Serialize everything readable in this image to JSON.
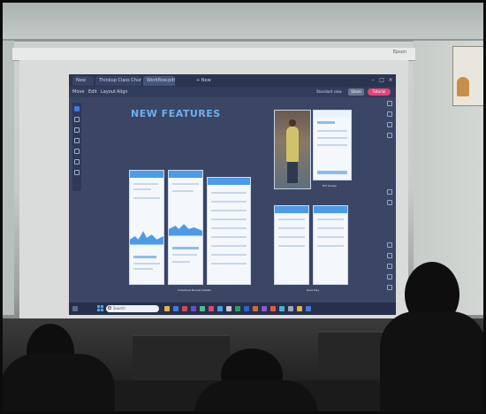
{
  "photo": {
    "description_colors": {
      "desktop_bg": "#3a4664",
      "accent_blue": "#4d9be8",
      "pink_button": "#e0457a"
    }
  },
  "poster": {
    "text": "",
    "figure": "poster-figure"
  },
  "screen": {
    "brand": "Epson"
  },
  "desktop": {
    "tabs": [
      "New",
      "Thinkup Class Church Studio",
      "Workflow.pdf",
      "+  New"
    ],
    "menu": [
      "Move",
      "Edit",
      "Layout",
      "Align"
    ],
    "zoom_label": "Standard view",
    "share_label": "Share",
    "tutorial_label": "Tutorial",
    "canvas": {
      "headline": "NEW FEATURES",
      "subhead": "",
      "paragraph": "",
      "caption_left": "Individual Runner Details",
      "caption_right_top": "Full Screen",
      "caption_right_bottom": "Race Day"
    },
    "taskbar": {
      "search_placeholder": "Search",
      "clock_time": "",
      "clock_date": ""
    }
  }
}
